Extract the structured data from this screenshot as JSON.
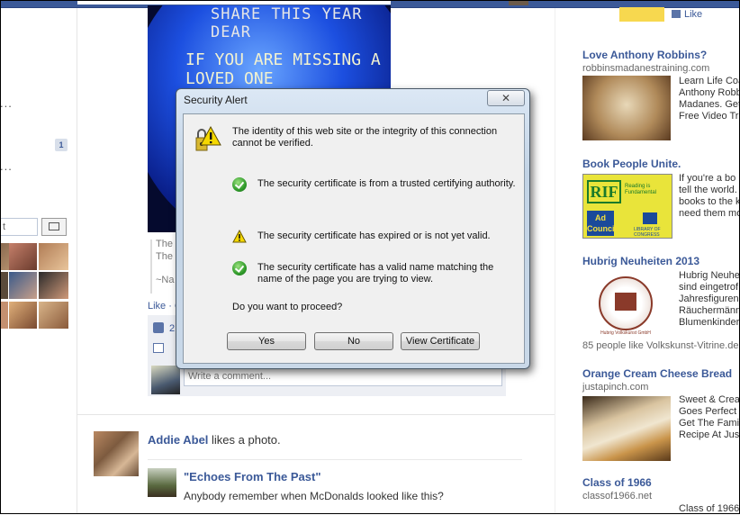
{
  "feed": {
    "image_text_line1": "SHARE THIS YEAR DEAR",
    "image_text_line2": "IF YOU ARE MISSING A LOVED ONE",
    "caption_l1": "The",
    "caption_l2": "The",
    "caption_l3": "~Na",
    "like_link": "Like · C",
    "like_count": "2",
    "comment_placeholder": "Write a comment...",
    "story_actor": "Addie Abel",
    "story_action": " likes a photo.",
    "sub_title": "\"Echoes From The Past\"",
    "sub_desc": "Anybody remember when McDonalds looked like this?"
  },
  "left": {
    "dots1": "...",
    "dots2": "...",
    "badge": "1",
    "search_value": "t"
  },
  "right": {
    "top_like": "Like",
    "ads": [
      {
        "title": "Love Anthony Robbins?",
        "url": "robbinsmadanestraining.com",
        "desc": [
          "Learn Life Coa",
          "Anthony Robb",
          "Madanes. Get",
          "Free Video Tra"
        ]
      },
      {
        "title": "Book People Unite.",
        "url": "",
        "desc": [
          "If you're a bo",
          "tell the world.",
          "books to the k",
          "need them mo"
        ]
      },
      {
        "title": "Hubrig Neuheiten 2013",
        "url": "",
        "desc": [
          "Hubrig Neuhe",
          "sind eingetrof",
          "Jahresfiguren",
          "Räuchermänn",
          "Blumenkinder!"
        ],
        "likes": "85 people like Volkskunst-Vitrine.de."
      },
      {
        "title": "Orange Cream Cheese Bread",
        "url": "justapinch.com",
        "desc": [
          "Sweet & Crea",
          "Goes Perfect",
          "Get The Famil",
          "Recipe At Jus"
        ]
      },
      {
        "title": "Class of 1966",
        "url": "classof1966.net",
        "desc": [
          "Class of 1966"
        ]
      }
    ],
    "rif_top": "RIF",
    "rif_tag": "Reading is Fundamental",
    "ad_council": "Ad Council",
    "loc": "LIBRARY OF CONGRESS",
    "hubrig_seal": "Hubrig Volkskunst GmbH"
  },
  "dialog": {
    "title": "Security Alert",
    "close": "✕",
    "message": "The identity of this web site or the integrity of this connection cannot be verified.",
    "item1": "The security certificate is from a trusted certifying authority.",
    "item2": "The security certificate has expired or is not yet valid.",
    "item3": "The security certificate has a valid name matching the name of the page you are trying to view.",
    "question": "Do you want to proceed?",
    "yes": "Yes",
    "no": "No",
    "view_cert": "View Certificate"
  }
}
